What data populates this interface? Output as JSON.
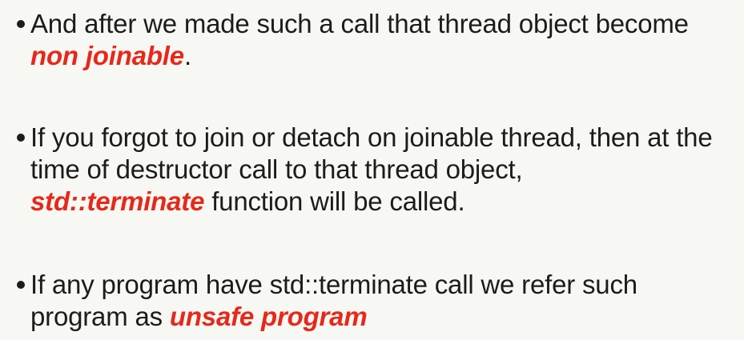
{
  "bullets": [
    {
      "before": "And after we made such a call that thread object become",
      "highlight": "non joinable",
      "after": "."
    },
    {
      "before": "If you forgot to join or detach on joinable thread, then at the time of destructor call to that thread object,",
      "highlight": "std::terminate",
      "after": " function will be called."
    },
    {
      "before": "If any program have std::terminate call we refer such program as",
      "highlight": "unsafe program",
      "after": ""
    }
  ],
  "colors": {
    "background": "#f7f8f3",
    "text": "#1c1c1c",
    "highlight": "#e8271b"
  }
}
